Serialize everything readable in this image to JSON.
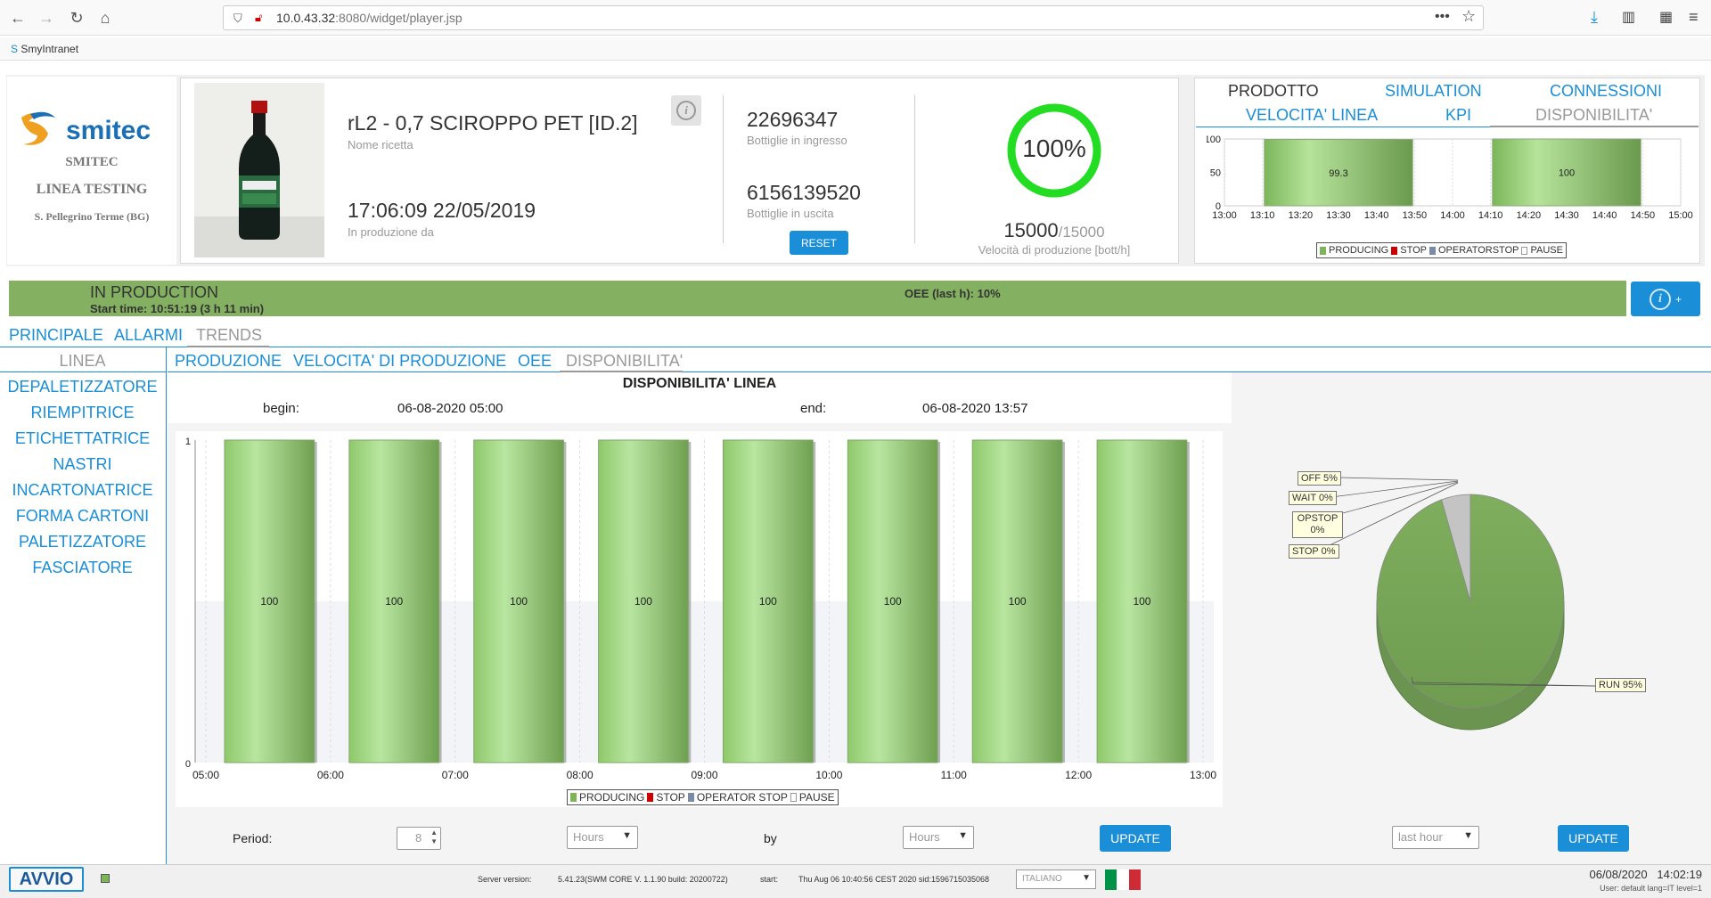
{
  "browser": {
    "url_host": "10.0.43.32",
    "url_rest": ":8080/widget/player.jsp",
    "bookmark": "SmyIntranet"
  },
  "brand": {
    "logo": "smitec",
    "company": "SMITEC",
    "line": "LINEA TESTING",
    "location": "S. Pellegrino Terme (BG)"
  },
  "recipe": {
    "name": "rL2 - 0,7 SCIROPPO PET [ID.2]",
    "name_label": "Nome ricetta",
    "datetime": "17:06:09 22/05/2019",
    "datetime_label": "In produzione da"
  },
  "counters": {
    "in_value": "22696347",
    "in_label": "Bottiglie in ingresso",
    "out_value": "6156139520",
    "out_label": "Bottiglie in uscita",
    "reset": "RESET"
  },
  "speed": {
    "percent": "100%",
    "percent_value": 100,
    "current": "15000",
    "max": "/15000",
    "label": "Velocità di produzione [bott/h]"
  },
  "top_tabs": {
    "row1": [
      "PRODOTTO",
      "SIMULATION",
      "CONNESSIONI"
    ],
    "row2": [
      "VELOCITA' LINEA",
      "KPI",
      "DISPONIBILITA'"
    ]
  },
  "mini_chart": {
    "yticks": [
      "100",
      "50",
      "0"
    ],
    "xticks": [
      "13:00",
      "13:10",
      "13:20",
      "13:30",
      "13:40",
      "13:50",
      "14:00",
      "14:10",
      "14:20",
      "14:30",
      "14:40",
      "14:50",
      "15:00"
    ],
    "bars": [
      {
        "label": "99.3",
        "value": 99.3
      },
      {
        "label": "100",
        "value": 100
      }
    ],
    "legend": [
      "PRODUCING",
      "STOP",
      "OPERATORSTOP",
      "PAUSE"
    ]
  },
  "status": {
    "state": "IN PRODUCTION",
    "start": "Start time: 10:51:19 (3 h 11 min)",
    "oee": "OEE (last h): 10%",
    "info_btn": "i +"
  },
  "main_tabs": [
    "PRINCIPALE",
    "ALLARMI",
    "TRENDS"
  ],
  "side_menu": {
    "header": "LINEA",
    "items": [
      "DEPALETIZZATORE",
      "RIEMPITRICE",
      "ETICHETTATRICE",
      "NASTRI",
      "INCARTONATRICE",
      "FORMA CARTONI",
      "PALETIZZATORE",
      "FASCIATORE"
    ]
  },
  "sub_tabs": [
    "PRODUZIONE",
    "VELOCITA' DI PRODUZIONE",
    "OEE",
    "DISPONIBILITA'"
  ],
  "chart_header": {
    "title": "DISPONIBILITA' LINEA",
    "begin_label": "begin:",
    "begin_value": "06-08-2020 05:00",
    "end_label": "end:",
    "end_value": "06-08-2020 13:57"
  },
  "chart_data": [
    {
      "type": "bar",
      "categories": [
        "05:00",
        "06:00",
        "07:00",
        "08:00",
        "09:00",
        "10:00",
        "11:00",
        "12:00"
      ],
      "values": [
        100,
        100,
        100,
        100,
        100,
        100,
        100,
        100
      ],
      "xticks": [
        "05:00",
        "06:00",
        "07:00",
        "08:00",
        "09:00",
        "10:00",
        "11:00",
        "12:00",
        "13:00"
      ],
      "yticks": [
        "1",
        "0"
      ],
      "title": "DISPONIBILITA' LINEA",
      "legend": [
        "PRODUCING",
        "STOP",
        "OPERATOR STOP",
        "PAUSE"
      ],
      "series_colors": {
        "PRODUCING": "#7fb55a",
        "STOP": "#cc0000",
        "OPERATOR STOP": "#7a8ba8",
        "PAUSE": "#ffffff"
      }
    },
    {
      "type": "pie",
      "labels": [
        "OFF  5%",
        "WAIT  0%",
        "OPSTOP 0%",
        "STOP  0%",
        "RUN  95%"
      ],
      "values": [
        5,
        0,
        0,
        0,
        95
      ],
      "colors": [
        "#c0c0c0",
        "#ffd700",
        "#7a8ba8",
        "#cc0000",
        "#84b061"
      ]
    }
  ],
  "controls": {
    "period_label": "Period:",
    "period_value": "8",
    "hours1": "Hours",
    "by_label": "by",
    "hours2": "Hours",
    "update": "UPDATE",
    "last_hour": "last hour",
    "update2": "UPDATE"
  },
  "footer": {
    "avvio": "AVVIO",
    "server_label": "Server version:",
    "server_value": "5.41.23(SWM CORE V. 1.1.90 build: 20200722)",
    "start_label": "start:",
    "start_value": "Thu Aug 06 10:40:56 CEST 2020 sid:1596715035068",
    "language": "ITALIANO",
    "datetime": "06/08/2020   14:02:19",
    "user": "User: default lang=IT level=1"
  }
}
